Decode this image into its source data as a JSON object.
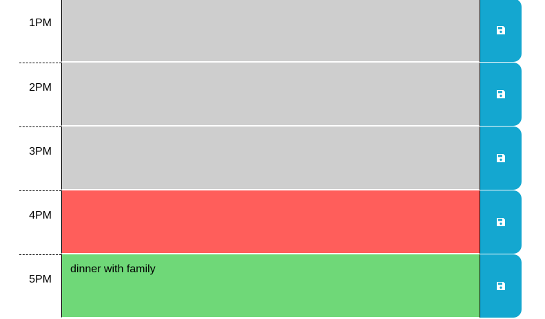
{
  "time_blocks": [
    {
      "hour": "1PM",
      "description": "",
      "state": "past"
    },
    {
      "hour": "2PM",
      "description": "",
      "state": "past"
    },
    {
      "hour": "3PM",
      "description": "",
      "state": "past"
    },
    {
      "hour": "4PM",
      "description": "",
      "state": "present"
    },
    {
      "hour": "5PM",
      "description": "dinner with family",
      "state": "future"
    }
  ],
  "colors": {
    "past": "#cecece",
    "present": "#ff5e5b",
    "future": "#6fd878",
    "save_button": "#14a7d0"
  },
  "icons": {
    "save": "floppy-disk-icon"
  }
}
